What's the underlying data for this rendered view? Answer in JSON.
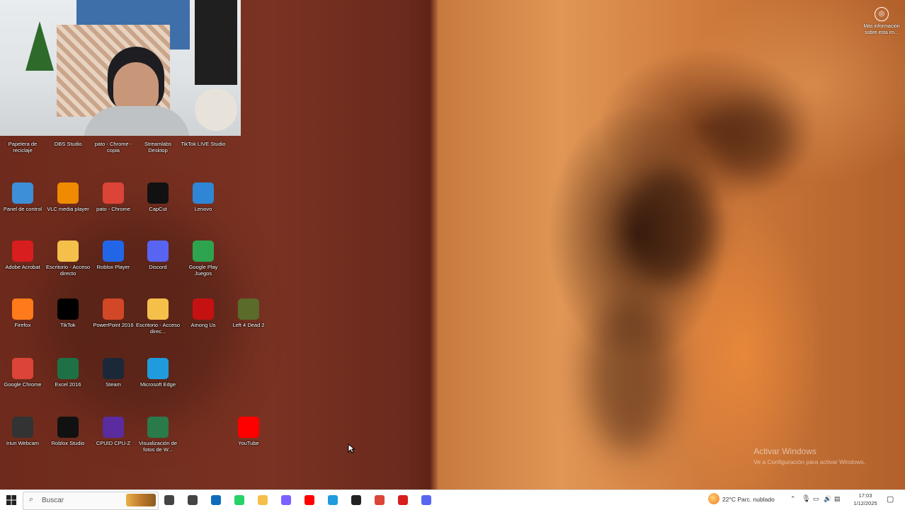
{
  "desktop": {
    "watermark_title": "Activar Windows",
    "watermark_subtitle": "Ve a Configuración para activar Windows.",
    "info_label": "Más información sobre esta im..."
  },
  "icons_partial_top": [
    {
      "label": "Papelera de reciclaje"
    },
    {
      "label": "OBS Studio"
    },
    {
      "label": "pato - Chrome - copia"
    },
    {
      "label": "Streamlabs Desktop"
    },
    {
      "label": "TikTok LIVE Studio"
    }
  ],
  "icons": [
    {
      "label": "Panel de control",
      "icon": "control-panel-icon",
      "color": "#3d8fd6"
    },
    {
      "label": "VLC media player",
      "icon": "vlc-icon",
      "color": "#f08a00"
    },
    {
      "label": "pato - Chrome",
      "icon": "chrome-icon",
      "color": "#db4437"
    },
    {
      "label": "CapCut",
      "icon": "capcut-icon",
      "color": "#111111"
    },
    {
      "label": "Lenovo",
      "icon": "lenovo-icon",
      "color": "#2f86d6"
    },
    {
      "label": "Adobe Acrobat",
      "icon": "adobe-acrobat-icon",
      "color": "#d81e1e"
    },
    {
      "label": "Escritorio - Acceso directo",
      "icon": "folder-icon",
      "color": "#f4c04a"
    },
    {
      "label": "Roblox Player",
      "icon": "roblox-player-icon",
      "color": "#2266e8"
    },
    {
      "label": "Discord",
      "icon": "discord-icon",
      "color": "#5865f2"
    },
    {
      "label": "Google Play Juegos",
      "icon": "google-play-games-icon",
      "color": "#2ea44f"
    },
    {
      "label": "Firefox",
      "icon": "firefox-icon",
      "color": "#ff7a1a"
    },
    {
      "label": "TikTok",
      "icon": "tiktok-icon",
      "color": "#000000"
    },
    {
      "label": "PowerPoint 2016",
      "icon": "powerpoint-icon",
      "color": "#d24726"
    },
    {
      "label": "Escritorio - Acceso direc...",
      "icon": "folder-icon",
      "color": "#f4c04a"
    },
    {
      "label": "Among Us",
      "icon": "among-us-icon",
      "color": "#c51111"
    },
    {
      "label": "Left 4 Dead 2",
      "icon": "left4dead2-icon",
      "color": "#5a6b2a"
    },
    {
      "label": "Google Chrome",
      "icon": "chrome-icon",
      "color": "#db4437"
    },
    {
      "label": "Excel 2016",
      "icon": "excel-icon",
      "color": "#1e7145"
    },
    {
      "label": "Steam",
      "icon": "steam-icon",
      "color": "#1b2838"
    },
    {
      "label": "Microsoft Edge",
      "icon": "edge-icon",
      "color": "#1f9bde"
    },
    {
      "label": "Iriun Webcam",
      "icon": "iriun-webcam-icon",
      "color": "#333333"
    },
    {
      "label": "Roblox Studio",
      "icon": "roblox-studio-icon",
      "color": "#111111"
    },
    {
      "label": "CPUID CPU-Z",
      "icon": "cpuz-icon",
      "color": "#5a2ca0"
    },
    {
      "label": "Visualización de fotos de W...",
      "icon": "photo-viewer-icon",
      "color": "#2a7a4a"
    },
    {
      "label": "YouTube",
      "icon": "youtube-icon",
      "color": "#ff0000"
    }
  ],
  "taskbar": {
    "search_placeholder": "Buscar",
    "weather": "22°C  Parc. nublado",
    "time": "17:03",
    "date": "1/12/2025",
    "apps": [
      {
        "name": "task-view-icon",
        "color": "#444444"
      },
      {
        "name": "file-explorer-taskbar-icon",
        "color": "#444444"
      },
      {
        "name": "outlook-icon",
        "color": "#0f6cbd"
      },
      {
        "name": "whatsapp-icon",
        "color": "#25d366"
      },
      {
        "name": "folder-taskbar-icon",
        "color": "#f4c04a"
      },
      {
        "name": "copilot-icon",
        "color": "#7b61ff"
      },
      {
        "name": "youtube-taskbar-icon",
        "color": "#ff0000"
      },
      {
        "name": "edge-taskbar-icon",
        "color": "#1f9bde"
      },
      {
        "name": "obs-taskbar-icon",
        "color": "#222222"
      },
      {
        "name": "chrome-taskbar-icon",
        "color": "#db4437"
      },
      {
        "name": "record-icon",
        "color": "#d81e1e"
      },
      {
        "name": "discord-taskbar-icon",
        "color": "#5865f2"
      }
    ]
  }
}
